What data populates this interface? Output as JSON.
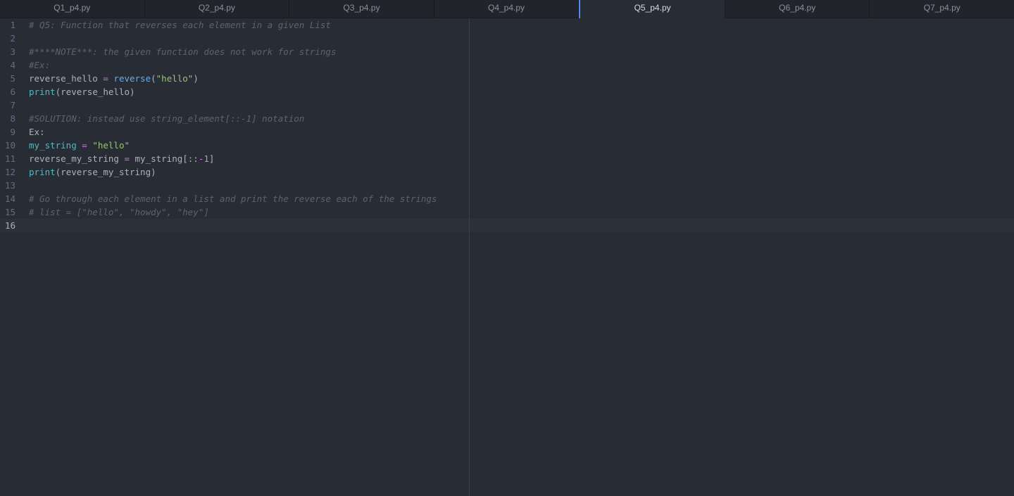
{
  "tabs": [
    {
      "label": "Q1_p4.py"
    },
    {
      "label": "Q2_p4.py"
    },
    {
      "label": "Q3_p4.py"
    },
    {
      "label": "Q4_p4.py"
    },
    {
      "label": "Q5_p4.py",
      "active": true
    },
    {
      "label": "Q6_p4.py"
    },
    {
      "label": "Q7_p4.py"
    }
  ],
  "editor": {
    "current_line": 16,
    "lines": [
      {
        "n": "1",
        "tokens": [
          {
            "t": "comment",
            "v": "# Q5: Function that reverses each element in a given List"
          }
        ]
      },
      {
        "n": "2",
        "tokens": []
      },
      {
        "n": "3",
        "tokens": [
          {
            "t": "comment",
            "v": "#****NOTE***: the given function does not work for strings"
          }
        ]
      },
      {
        "n": "4",
        "tokens": [
          {
            "t": "comment",
            "v": "#Ex:"
          }
        ]
      },
      {
        "n": "5",
        "tokens": [
          {
            "t": "plain",
            "v": "reverse_hello "
          },
          {
            "t": "op",
            "v": "="
          },
          {
            "t": "plain",
            "v": " "
          },
          {
            "t": "fn",
            "v": "reverse"
          },
          {
            "t": "plain",
            "v": "("
          },
          {
            "t": "str",
            "v": "\"hello\""
          },
          {
            "t": "plain",
            "v": ")"
          }
        ]
      },
      {
        "n": "6",
        "tokens": [
          {
            "t": "builtin",
            "v": "print"
          },
          {
            "t": "plain",
            "v": "(reverse_hello)"
          }
        ]
      },
      {
        "n": "7",
        "tokens": []
      },
      {
        "n": "8",
        "tokens": [
          {
            "t": "comment",
            "v": "#SOLUTION: instead use string_element[::-1] notation"
          }
        ]
      },
      {
        "n": "9",
        "tokens": [
          {
            "t": "plain",
            "v": "Ex:"
          }
        ]
      },
      {
        "n": "10",
        "tokens": [
          {
            "t": "builtin",
            "v": "my_string"
          },
          {
            "t": "plain",
            "v": " "
          },
          {
            "t": "op",
            "v": "="
          },
          {
            "t": "plain",
            "v": " "
          },
          {
            "t": "str",
            "v": "\"hello\""
          }
        ]
      },
      {
        "n": "11",
        "tokens": [
          {
            "t": "plain",
            "v": "reverse_my_string "
          },
          {
            "t": "op",
            "v": "="
          },
          {
            "t": "plain",
            "v": " my_string[::"
          },
          {
            "t": "op",
            "v": "-"
          },
          {
            "t": "num",
            "v": "1"
          },
          {
            "t": "plain",
            "v": "]"
          }
        ]
      },
      {
        "n": "12",
        "tokens": [
          {
            "t": "builtin",
            "v": "print"
          },
          {
            "t": "plain",
            "v": "(reverse_my_string)"
          }
        ]
      },
      {
        "n": "13",
        "tokens": []
      },
      {
        "n": "14",
        "tokens": [
          {
            "t": "comment",
            "v": "# Go through each element in a list and print the reverse each of the strings"
          }
        ]
      },
      {
        "n": "15",
        "tokens": [
          {
            "t": "comment",
            "v": "# list = [\"hello\", \"howdy\", \"hey\"]"
          }
        ]
      },
      {
        "n": "16",
        "tokens": []
      }
    ]
  },
  "colors": {
    "background": "#282c34",
    "tab_bar": "#21252b",
    "active_tab_accent": "#568af2",
    "comment": "#5c6370",
    "function": "#61afef",
    "builtin": "#56b6c2",
    "operator": "#c678dd",
    "string": "#98c379",
    "number": "#d19a66"
  }
}
